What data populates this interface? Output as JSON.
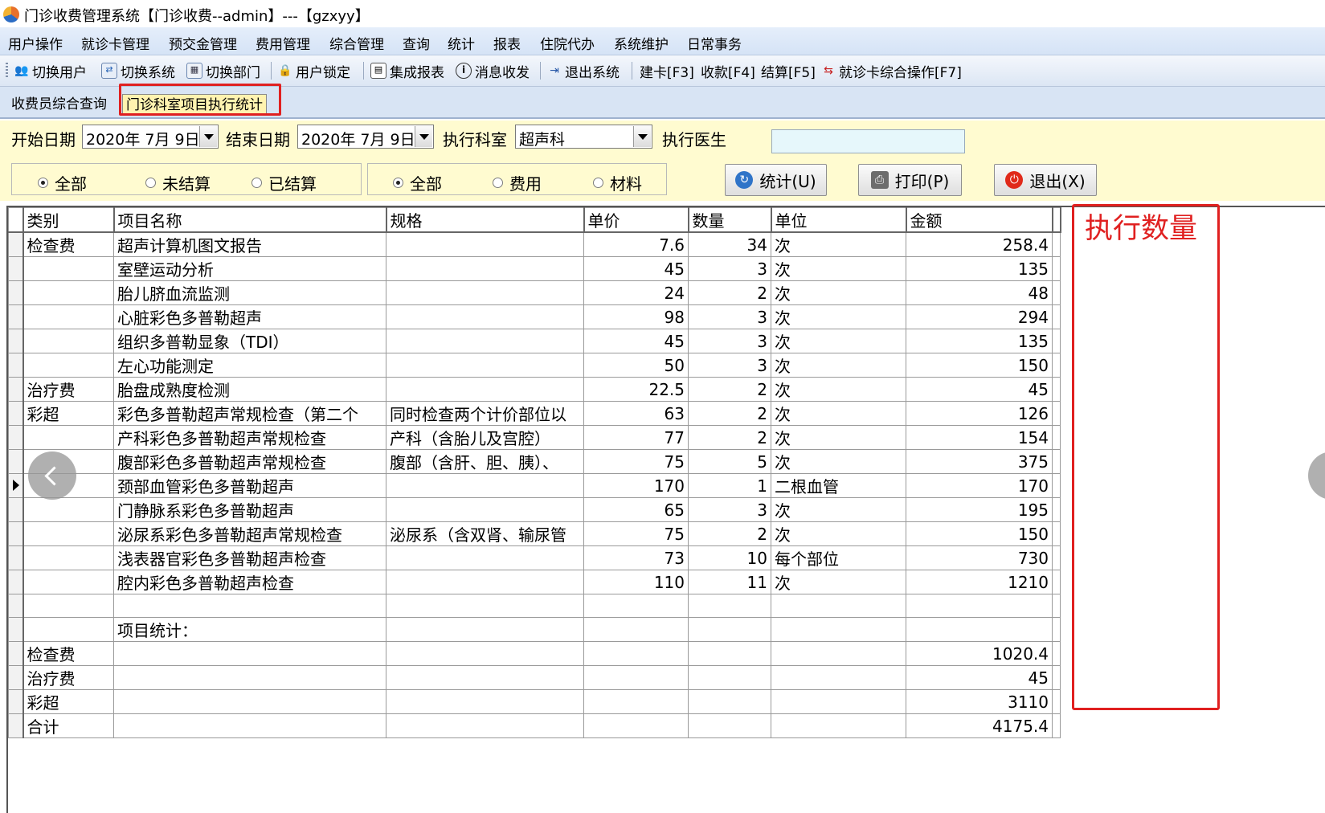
{
  "window": {
    "title": "门诊收费管理系统【门诊收费--admin】---【gzxyy】"
  },
  "menu": {
    "items": [
      "用户操作",
      "就诊卡管理",
      "预交金管理",
      "费用管理",
      "综合管理",
      "查询",
      "统计",
      "报表",
      "住院代办",
      "系统维护",
      "日常事务"
    ]
  },
  "toolbar": {
    "switch_user": "切换用户",
    "switch_system": "切换系统",
    "switch_dept": "切换部门",
    "user_lock": "用户锁定",
    "integrated_report": "集成报表",
    "messages": "消息收发",
    "exit_system": "退出系统",
    "create_card": "建卡[F3]",
    "collect": "收款[F4]",
    "settle": "结算[F5]",
    "card_ops": "就诊卡综合操作[F7]"
  },
  "tabs": [
    {
      "label": "收费员综合查询"
    },
    {
      "label": "门诊科室项目执行统计"
    }
  ],
  "filters": {
    "start_label": "开始日期",
    "start_value": "2020年 7月 9日",
    "end_label": "结束日期",
    "end_value": "2020年 7月 9日",
    "dept_label": "执行科室",
    "dept_value": "超声科",
    "doctor_label": "执行医生",
    "doctor_value": "",
    "status_radios": [
      "全部",
      "未结算",
      "已结算"
    ],
    "type_radios": [
      "全部",
      "费用",
      "材料"
    ]
  },
  "buttons": {
    "stats": "统计(U)",
    "print": "打印(P)",
    "exit": "退出(X)"
  },
  "table": {
    "headers": [
      "类别",
      "项目名称",
      "规格",
      "单价",
      "数量",
      "单位",
      "金额"
    ],
    "rows": [
      [
        "检查费",
        "超声计算机图文报告",
        "",
        "7.6",
        "34",
        "次",
        "258.4"
      ],
      [
        "",
        "室壁运动分析",
        "",
        "45",
        "3",
        "次",
        "135"
      ],
      [
        "",
        "胎儿脐血流监测",
        "",
        "24",
        "2",
        "次",
        "48"
      ],
      [
        "",
        "心脏彩色多普勒超声",
        "",
        "98",
        "3",
        "次",
        "294"
      ],
      [
        "",
        "组织多普勒显象（TDI）",
        "",
        "45",
        "3",
        "次",
        "135"
      ],
      [
        "",
        "左心功能测定",
        "",
        "50",
        "3",
        "次",
        "150"
      ],
      [
        "治疗费",
        "胎盘成熟度检测",
        "",
        "22.5",
        "2",
        "次",
        "45"
      ],
      [
        "彩超",
        "彩色多普勒超声常规检查（第二个",
        "同时检查两个计价部位以",
        "63",
        "2",
        "次",
        "126"
      ],
      [
        "",
        "产科彩色多普勒超声常规检查",
        "产科（含胎儿及宫腔）",
        "77",
        "2",
        "次",
        "154"
      ],
      [
        "",
        "腹部彩色多普勒超声常规检查",
        "腹部（含肝、胆、胰）、",
        "75",
        "5",
        "次",
        "375"
      ],
      [
        "",
        "颈部血管彩色多普勒超声",
        "",
        "170",
        "1",
        "二根血管",
        "170"
      ],
      [
        "",
        "门静脉系彩色多普勒超声",
        "",
        "65",
        "3",
        "次",
        "195"
      ],
      [
        "",
        "泌尿系彩色多普勒超声常规检查",
        "泌尿系（含双肾、输尿管",
        "75",
        "2",
        "次",
        "150"
      ],
      [
        "",
        "浅表器官彩色多普勒超声检查",
        "",
        "73",
        "10",
        "每个部位",
        "730"
      ],
      [
        "",
        "腔内彩色多普勒超声检查",
        "",
        "110",
        "11",
        "次",
        "1210"
      ],
      [
        "",
        "",
        "",
        "",
        "",
        "",
        ""
      ],
      [
        "",
        "项目统计：",
        "",
        "",
        "",
        "",
        ""
      ],
      [
        "检查费",
        "",
        "",
        "",
        "",
        "",
        "1020.4"
      ],
      [
        "治疗费",
        "",
        "",
        "",
        "",
        "",
        "45"
      ],
      [
        "彩超",
        "",
        "",
        "",
        "",
        "",
        "3110"
      ],
      [
        "合计",
        "",
        "",
        "",
        "",
        "",
        "4175.4"
      ]
    ]
  },
  "annotation": {
    "text": "执行数量"
  }
}
